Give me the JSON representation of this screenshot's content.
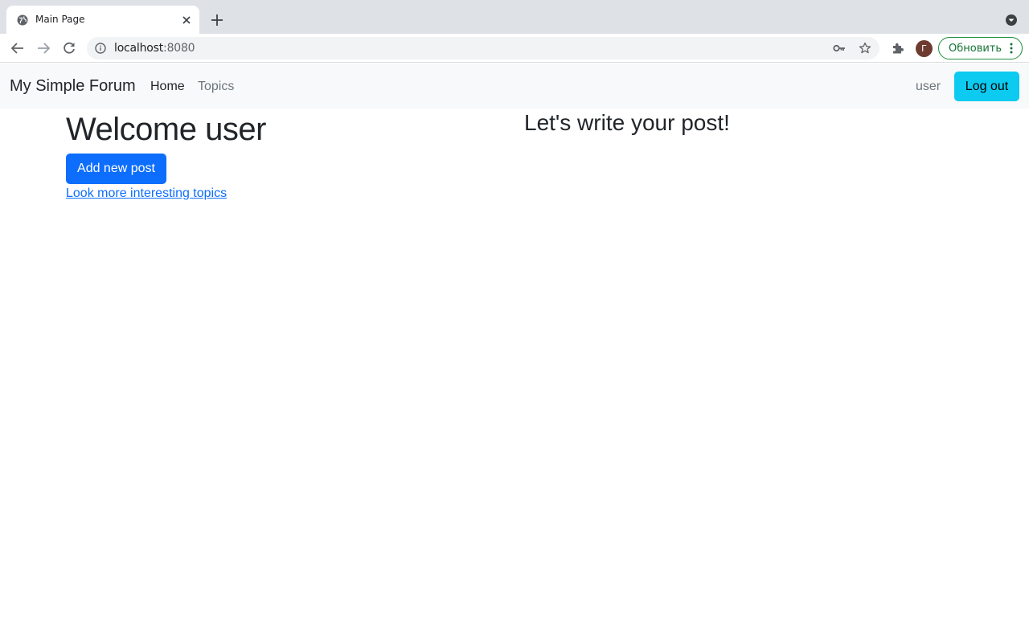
{
  "browser": {
    "tab_title": "Main Page",
    "url_host": "localhost",
    "url_port": ":8080",
    "avatar_letter": "Г",
    "update_label": "Обновить",
    "icons": {
      "favicon": "globe-icon",
      "close": "close-icon",
      "new_tab": "plus-icon",
      "tab_menu": "chevron-down-circle-icon",
      "back": "back-arrow-icon",
      "forward": "forward-arrow-icon",
      "reload": "reload-icon",
      "info": "info-icon",
      "key": "key-icon",
      "star": "star-icon",
      "extensions": "puzzle-icon",
      "menu": "more-vert-icon"
    },
    "colors": {
      "tabstrip": "#dee1e6",
      "update_green": "#1e8e3e",
      "avatar": "#6d3b30"
    }
  },
  "navbar": {
    "brand": "My Simple Forum",
    "links": [
      {
        "label": "Home",
        "active": true
      },
      {
        "label": "Topics",
        "active": false
      }
    ],
    "username": "user",
    "logout_label": "Log out",
    "logout_color": "#0dcaf0"
  },
  "main": {
    "welcome_heading": "Welcome user",
    "add_post_label": "Add new post",
    "add_post_color": "#0d6efd",
    "more_topics_link": "Look more interesting topics",
    "write_heading": "Let's write your post!"
  }
}
